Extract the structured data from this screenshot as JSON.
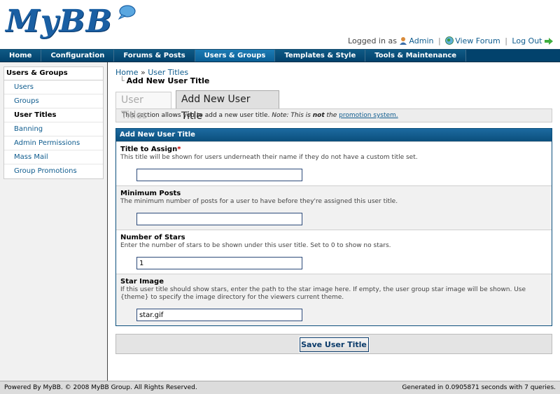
{
  "header": {
    "logo_text": "MyBB",
    "logged_in_text": "Logged in as",
    "username": "Admin",
    "view_forum": "View Forum",
    "logout": "Log Out"
  },
  "nav": {
    "items": [
      {
        "label": "Home"
      },
      {
        "label": "Configuration"
      },
      {
        "label": "Forums & Posts"
      },
      {
        "label": "Users & Groups",
        "active": true
      },
      {
        "label": "Templates & Style"
      },
      {
        "label": "Tools & Maintenance"
      }
    ]
  },
  "sidebar": {
    "title": "Users & Groups",
    "items": [
      {
        "label": "Users"
      },
      {
        "label": "Groups"
      },
      {
        "label": "User Titles",
        "active": true
      },
      {
        "label": "Banning"
      },
      {
        "label": "Admin Permissions"
      },
      {
        "label": "Mass Mail"
      },
      {
        "label": "Group Promotions"
      }
    ]
  },
  "breadcrumb": {
    "home": "Home",
    "separator": "»",
    "section": "User Titles",
    "current": "Add New User Title"
  },
  "tabs": {
    "inactive": "User Titles",
    "active": "Add New User Title"
  },
  "notice": {
    "text": "This section allows you to add a new user title.",
    "note_prefix": "Note: This is",
    "note_bold": "not",
    "note_suffix": "the",
    "link": "promotion system."
  },
  "form": {
    "heading": "Add New User Title",
    "fields": [
      {
        "label": "Title to Assign",
        "required_mark": "*",
        "description": "This title will be shown for users underneath their name if they do not have a custom title set.",
        "value": ""
      },
      {
        "label": "Minimum Posts",
        "description": "The minimum number of posts for a user to have before they're assigned this user title.",
        "value": ""
      },
      {
        "label": "Number of Stars",
        "description": "Enter the number of stars to be shown under this user title. Set to 0 to show no stars.",
        "value": "1"
      },
      {
        "label": "Star Image",
        "description": "If this user title should show stars, enter the path to the star image here. If empty, the user group star image will be shown. Use {theme} to specify the image directory for the viewers current theme.",
        "value": "star.gif"
      }
    ],
    "submit_label": "Save User Title"
  },
  "footer": {
    "left": "Powered By MyBB. © 2008 MyBB Group. All Rights Reserved.",
    "right": "Generated in 0.0905871 seconds with 7 queries."
  },
  "colors": {
    "nav_bg": "#02426c",
    "nav_active": "#0a5f95",
    "link": "#0f5c8e",
    "form_header": "#0b4f7c"
  }
}
